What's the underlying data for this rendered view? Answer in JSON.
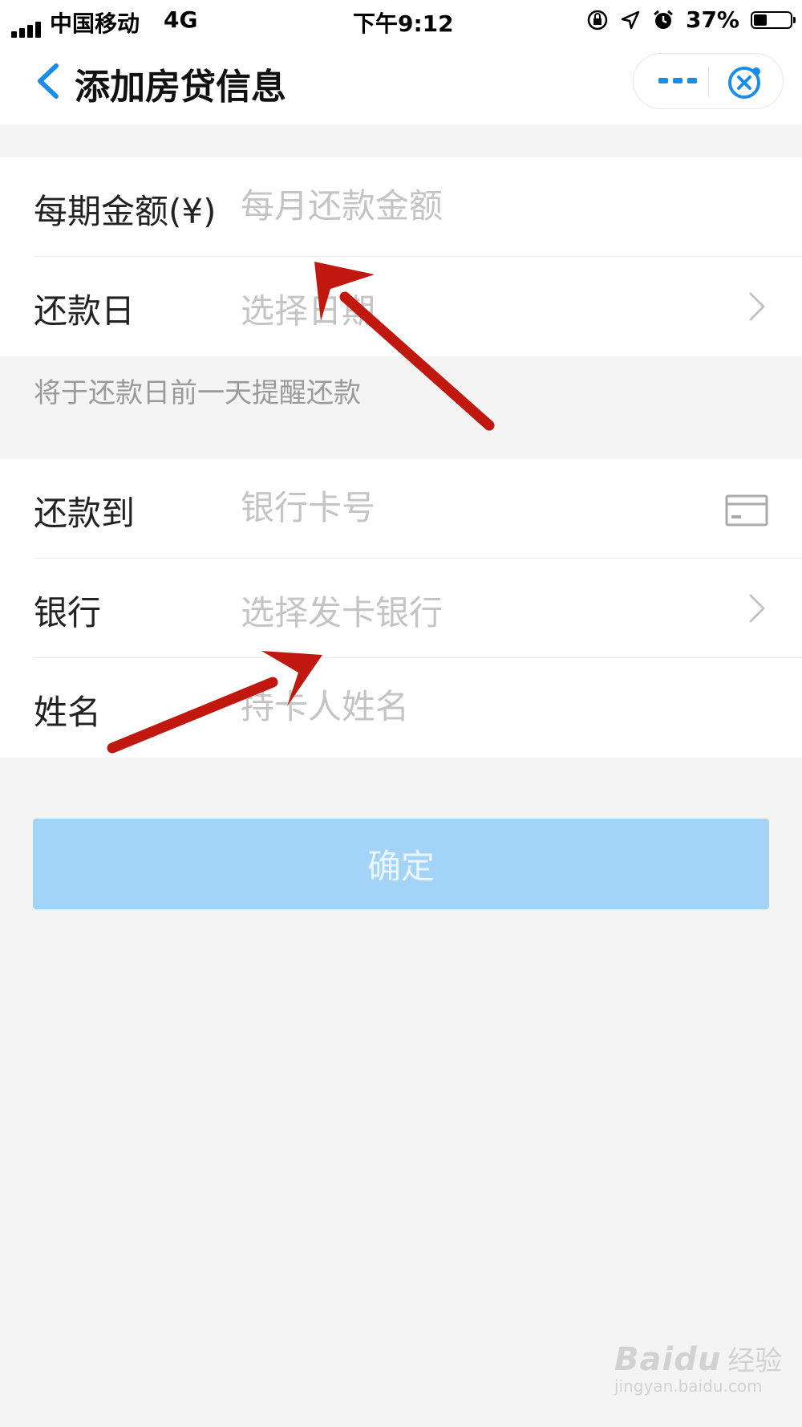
{
  "status_bar": {
    "carrier": "中国移动",
    "network": "4G",
    "time": "下午9:12",
    "battery": "37%",
    "battery_level": 0.37
  },
  "nav": {
    "title": "添加房贷信息"
  },
  "form": {
    "amount": {
      "label": "每期金额(¥)",
      "placeholder": "每月还款金额"
    },
    "repay_day": {
      "label": "还款日",
      "placeholder": "选择日期"
    },
    "hint": "将于还款日前一天提醒还款",
    "repay_to": {
      "label": "还款到",
      "placeholder": "银行卡号"
    },
    "bank": {
      "label": "银行",
      "placeholder": "选择发卡银行"
    },
    "name": {
      "label": "姓名",
      "placeholder": "持卡人姓名"
    }
  },
  "confirm_label": "确定",
  "watermark": {
    "brand": "Baidu",
    "brand_cn": "经验",
    "url": "jingyan.baidu.com"
  },
  "colors": {
    "accent": "#1a8de9",
    "button": "#a3d3f6",
    "arrow": "#c0180f"
  }
}
